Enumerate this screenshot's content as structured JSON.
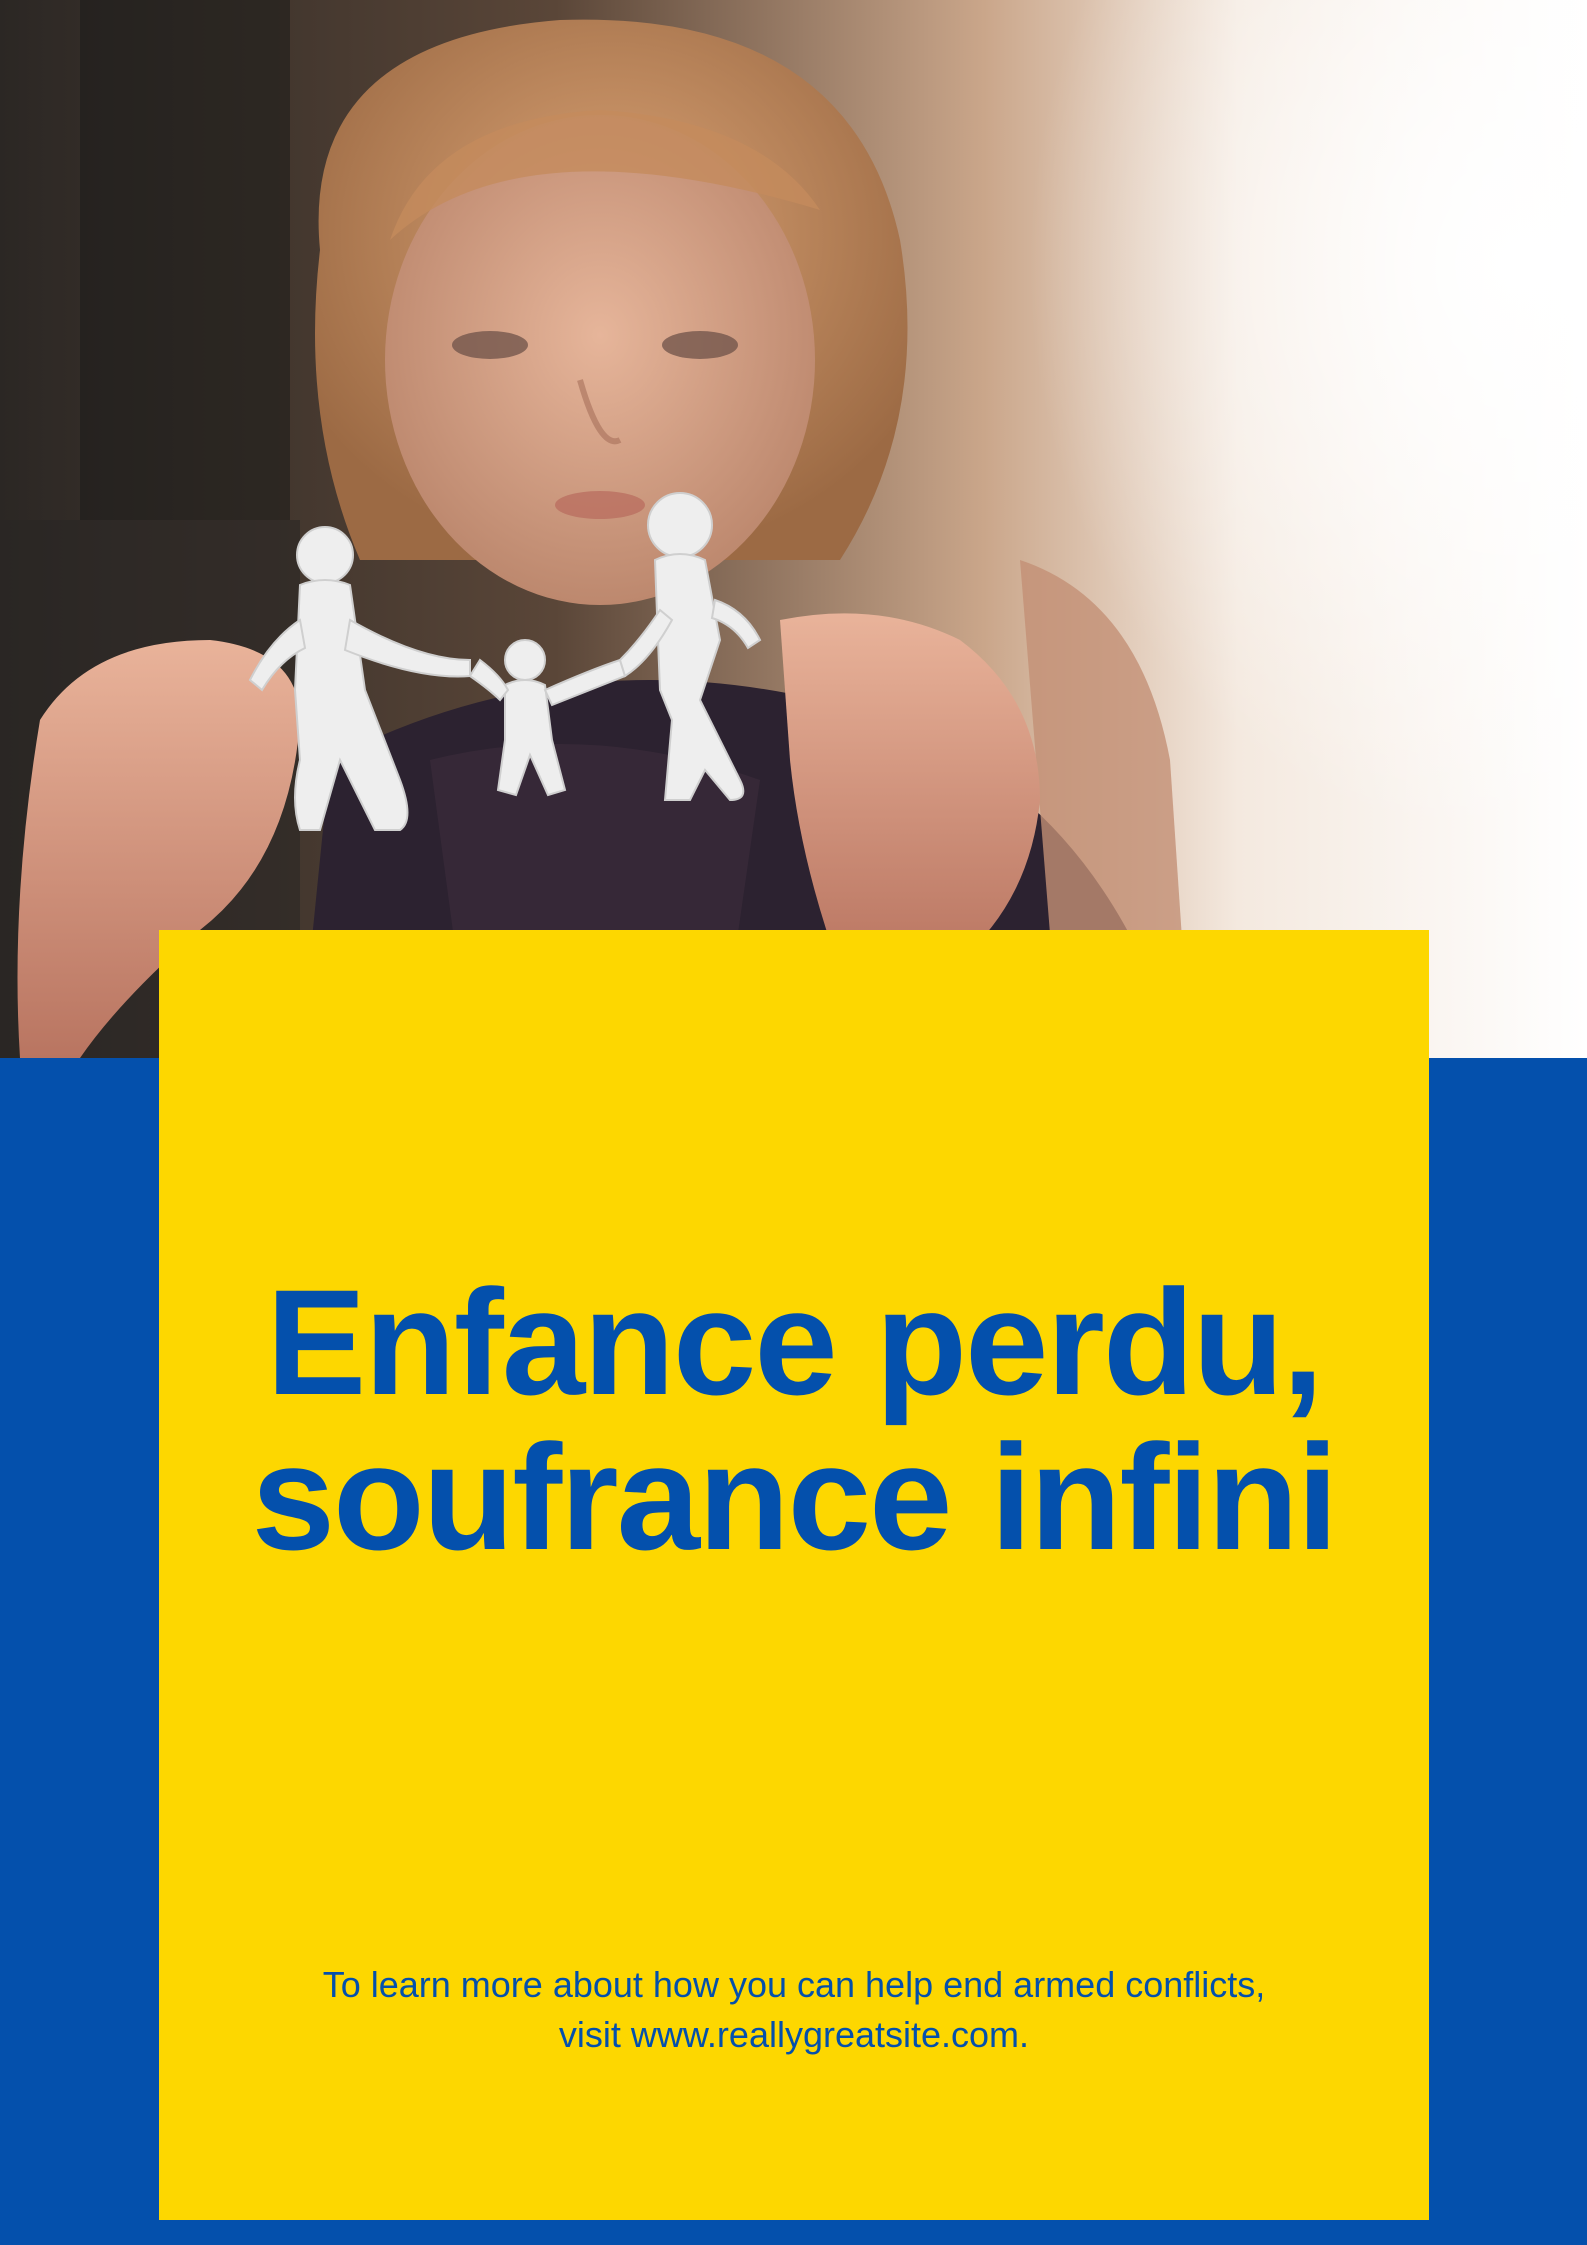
{
  "poster": {
    "headline": {
      "line1": "Enfance perdu,",
      "line2": "soufrance infini"
    },
    "info": {
      "line1": "To learn more about how you can help end armed conflicts,",
      "line2": "visit www.reallygreatsite.com."
    },
    "photo": {
      "subject": "child holding paper-cut family chain"
    }
  },
  "colors": {
    "background_blue": "#0450ac",
    "card_yellow": "#fdd700",
    "text_blue": "#0450ac"
  }
}
